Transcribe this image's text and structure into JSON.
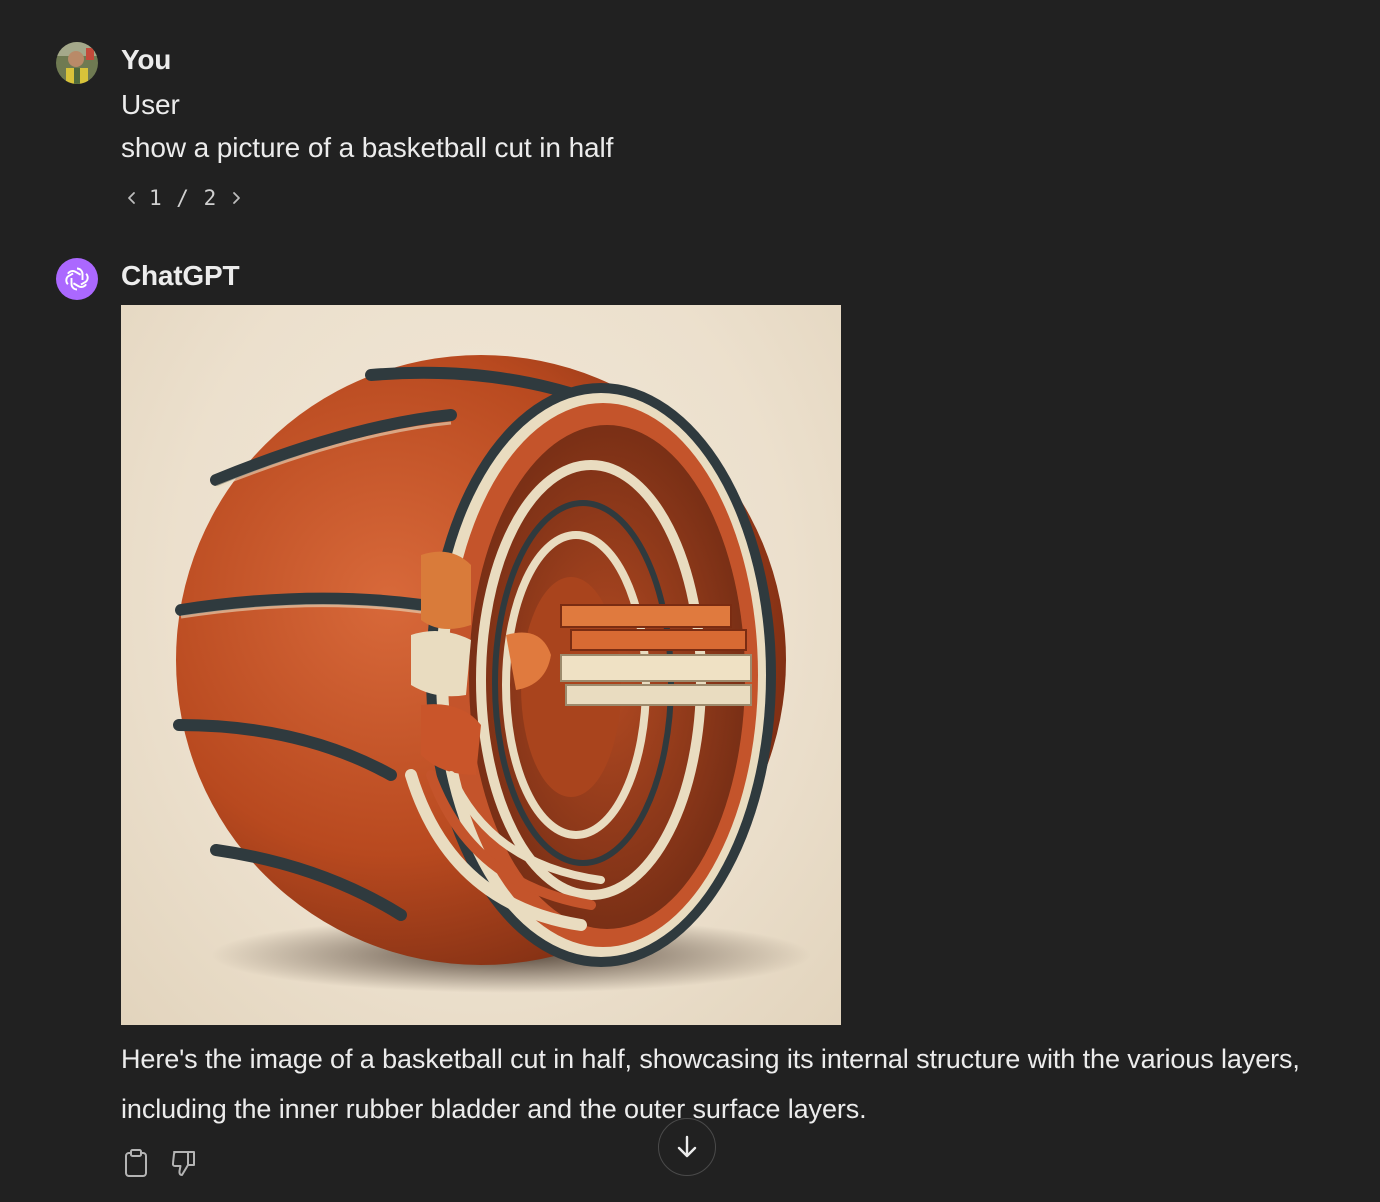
{
  "user_message": {
    "author": "You",
    "avatar_icon": "user-avatar-photo",
    "lines": [
      "User",
      "show a picture of a basketball cut in half"
    ],
    "pager": {
      "text": "1 / 2",
      "prev_icon": "chevron-left-icon",
      "next_icon": "chevron-right-icon"
    }
  },
  "assistant_message": {
    "author": "ChatGPT",
    "avatar_icon": "openai-logo-icon",
    "avatar_color": "#ab68ff",
    "image_subject": "basketball cut in half",
    "text": "Here's the image of a basketball cut in half, showcasing its internal structure with the various layers, including the inner rubber bladder and the outer surface layers.",
    "actions": [
      {
        "icon": "clipboard-icon"
      },
      {
        "icon": "thumbs-down-icon"
      }
    ]
  },
  "scroll_button": {
    "icon": "arrow-down-icon"
  },
  "colors": {
    "background": "#212121",
    "text": "#ececec",
    "ball_orange": "#c4542b"
  }
}
